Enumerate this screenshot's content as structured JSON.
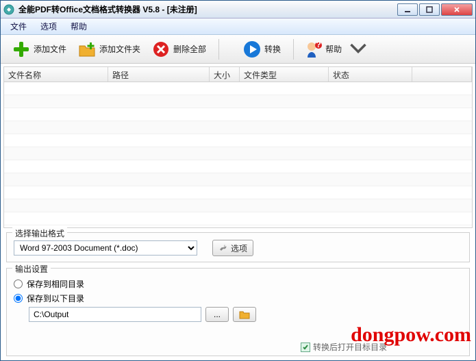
{
  "window": {
    "title": "全能PDF转Office文档格式转换器 V5.8  -  [未注册]"
  },
  "menu": {
    "file": "文件",
    "options": "选项",
    "help": "帮助"
  },
  "toolbar": {
    "add_file": "添加文件",
    "add_folder": "添加文件夹",
    "remove_all": "删除全部",
    "convert": "转换",
    "help": "帮助"
  },
  "columns": {
    "name": "文件名称",
    "path": "路径",
    "size": "大小",
    "type": "文件类型",
    "status": "状态"
  },
  "format_group": {
    "legend": "选择输出格式",
    "selected": "Word 97-2003 Document (*.doc)",
    "options_btn": "选项"
  },
  "output_group": {
    "legend": "输出设置",
    "same_folder": "保存到相同目录",
    "below_folder": "保存到以下目录",
    "path_value": "C:\\Output",
    "browse": "...",
    "open_after": "转换后打开目标目录"
  },
  "watermark": "dongpow.com"
}
